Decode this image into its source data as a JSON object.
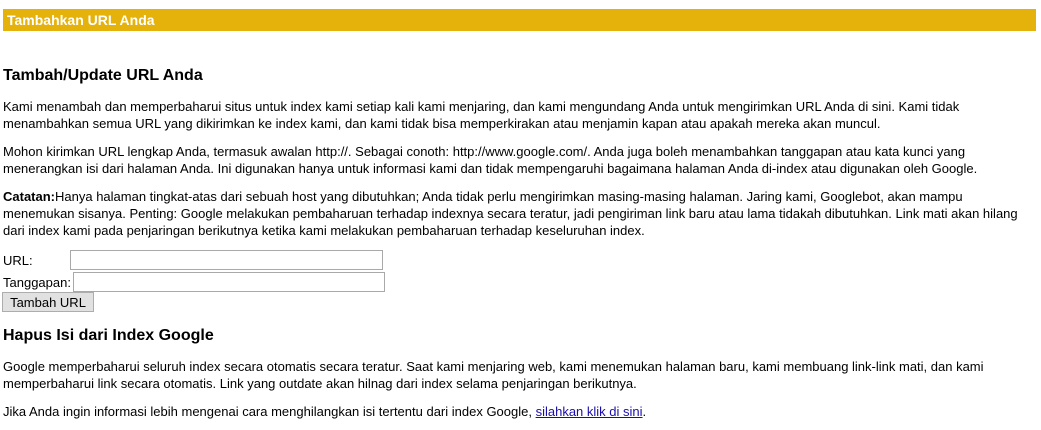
{
  "header": {
    "title": "Tambahkan URL Anda"
  },
  "add_section": {
    "heading": "Tambah/Update URL Anda",
    "para1": "Kami menambah dan memperbaharui situs untuk index kami setiap kali kami menjaring, dan kami mengundang Anda untuk mengirimkan URL Anda di sini. Kami tidak menambahkan semua URL yang dikirimkan ke index kami, dan kami tidak bisa memperkirakan atau menjamin kapan atau apakah mereka akan muncul.",
    "para2": "Mohon kirimkan URL lengkap Anda, termasuk awalan http://. Sebagai conoth: http://www.google.com/. Anda juga boleh menambahkan tanggapan atau kata kunci yang menerangkan isi dari halaman Anda. Ini digunakan hanya untuk informasi kami dan tidak mempengaruhi bagaimana halaman Anda di-index atau digunakan oleh Google.",
    "note_label": "Catatan:",
    "note_text": "Hanya halaman tingkat-atas dari sebuah host yang dibutuhkan; Anda tidak perlu mengirimkan masing-masing halaman. Jaring kami, Googlebot, akan mampu menemukan sisanya. Penting: Google melakukan pembaharuan terhadap indexnya secara teratur, jadi pengiriman link baru atau lama tidakah dibutuhkan. Link mati akan hilang dari index kami pada penjaringan berikutnya ketika kami melakukan pembaharuan terhadap keseluruhan index."
  },
  "form": {
    "url_label": "URL:",
    "url_value": "",
    "comment_label": "Tanggapan:",
    "comment_value": "",
    "submit_label": "Tambah URL"
  },
  "remove_section": {
    "heading": "Hapus Isi dari Index Google",
    "para1": "Google memperbaharui seluruh index secara otomatis secara teratur. Saat kami menjaring web, kami menemukan halaman baru, kami membuang link-link mati, dan kami memperbaharui link secara otomatis. Link yang outdate akan hilnag dari index selama penjaringan berikutnya.",
    "para2_prefix": "Jika Anda ingin informasi lebih mengenai cara menghilangkan isi tertentu dari index Google, ",
    "para2_link": "silahkan klik di sini",
    "para2_suffix": "."
  },
  "colors": {
    "banner": "#e5b20c",
    "banner_text": "#ffffff",
    "link": "#1a0dab"
  }
}
